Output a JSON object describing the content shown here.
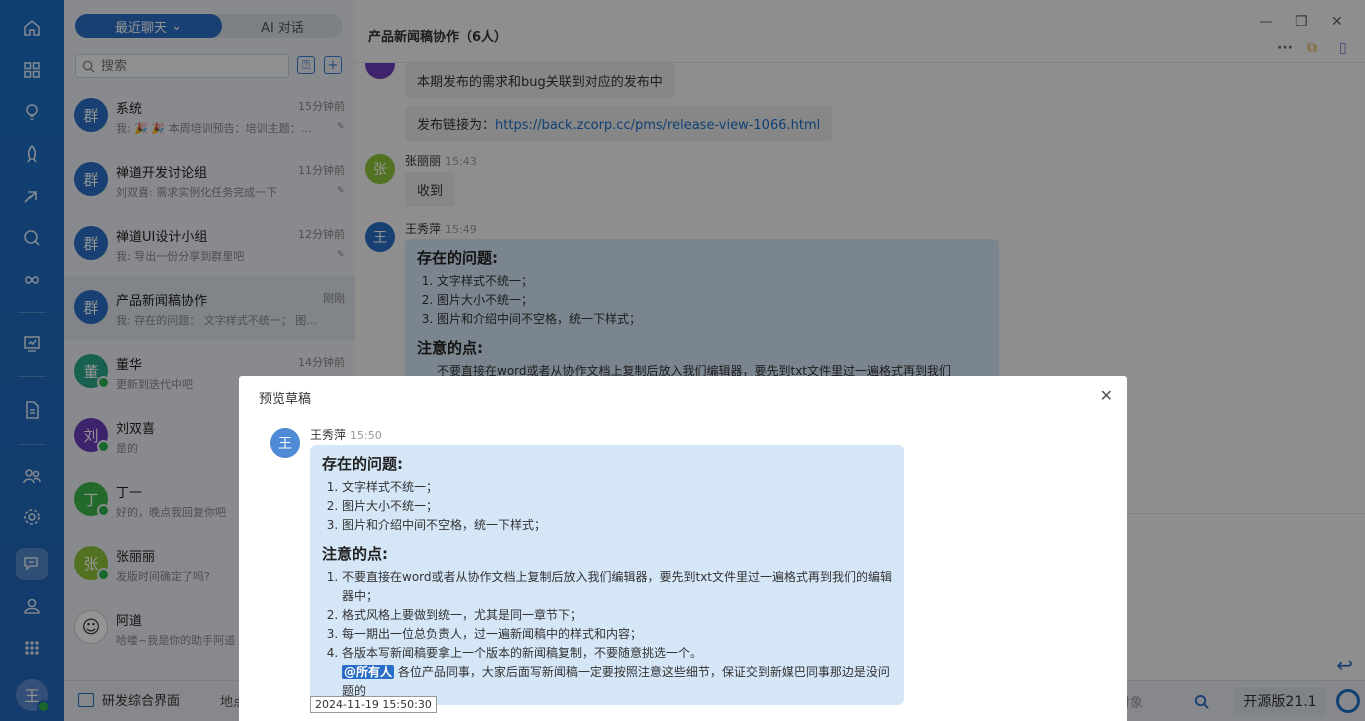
{
  "sidebar_tabs": {
    "recent": "最近聊天",
    "ai": "AI 对话"
  },
  "search": {
    "placeholder": "搜索"
  },
  "conversations": [
    {
      "avatar": "群",
      "name": "系统",
      "time": "15分钟前",
      "preview": "我: 🎉 🎉 本周培训预告：培训主题：…",
      "pinned": true,
      "color": "#2a6fc7"
    },
    {
      "avatar": "群",
      "name": "禅道开发讨论组",
      "time": "11分钟前",
      "preview": "刘双喜: 需求实例化任务完成一下",
      "pinned": true,
      "color": "#2a6fc7"
    },
    {
      "avatar": "群",
      "name": "禅道UI设计小组",
      "time": "12分钟前",
      "preview": "我: 导出一份分享到群里吧",
      "pinned": true,
      "color": "#2a6fc7"
    },
    {
      "avatar": "群",
      "name": "产品新闻稿协作",
      "time": "刚刚",
      "preview": "我: 存在的问题： 文字样式不统一； 图…",
      "pinned": false,
      "color": "#2a6fc7"
    },
    {
      "avatar": "董",
      "name": "董华",
      "time": "14分钟前",
      "preview": "更新到迭代中吧",
      "pinned": false,
      "color": "#2aa58a"
    },
    {
      "avatar": "刘",
      "name": "刘双喜",
      "time": "",
      "preview": "是的",
      "pinned": false,
      "color": "#6a3db8"
    },
    {
      "avatar": "丁",
      "name": "丁一",
      "time": "",
      "preview": "好的，晚点我回复你吧",
      "pinned": false,
      "color": "#3db54a"
    },
    {
      "avatar": "张",
      "name": "张丽丽",
      "time": "",
      "preview": "发版时间确定了吗?",
      "pinned": false,
      "color": "#8dc43a"
    },
    {
      "avatar": "",
      "name": "阿道",
      "time": "",
      "preview": "哈喽~我是你的助手阿道",
      "pinned": false,
      "color": "#ffffff"
    }
  ],
  "chat": {
    "title": "产品新闻稿协作（6人）",
    "msg1": "本期发布的需求和bug关联到对应的发布中",
    "msg2_prefix": "发布链接为：",
    "msg2_link": "https://back.zcorp.cc/pms/release-view-1066.html",
    "user3": {
      "avatar": "张",
      "name": "张丽丽",
      "time": "15:43",
      "text": "收到"
    },
    "user4": {
      "avatar": "王",
      "name": "王秀萍",
      "time": "15:49"
    },
    "rich_heading1": "存在的问题:",
    "rich_list1": [
      "文字样式不统一；",
      "图片大小不统一；",
      "图片和介绍中间不空格，统一下样式；"
    ],
    "rich_heading2": "注意的点:",
    "rich_list2_item1": "不要直接在word或者从协作文档上复制后放入我们编辑器，要先到txt文件里过一遍格式再到我们"
  },
  "statusbar": {
    "crumb": "研发综合界面",
    "crumb2": "地点",
    "search_placeholder": "请对象",
    "version": "开源版21.1"
  },
  "modal": {
    "title": "预览草稿",
    "avatar": "王",
    "name": "王秀萍",
    "time": "15:50",
    "heading1": "存在的问题:",
    "list1": [
      "文字样式不统一；",
      "图片大小不统一；",
      "图片和介绍中间不空格，统一下样式；"
    ],
    "heading2": "注意的点:",
    "list2": [
      "不要直接在word或者从协作文档上复制后放入我们编辑器，要先到txt文件里过一遍格式再到我们的编辑器中；",
      "格式风格上要做到统一，尤其是同一章节下；",
      "每一期出一位总负责人，过一遍新闻稿中的样式和内容；",
      "各版本写新闻稿要拿上一个版本的新闻稿复制，不要随意挑选一个。"
    ],
    "mention": "@所有人",
    "mention_text": "各位产品同事，大家后面写新闻稿一定要按照注意这些细节，保证交到新媒巴同事那边是没问题的",
    "timestamp": "2024-11-19 15:50:30"
  }
}
